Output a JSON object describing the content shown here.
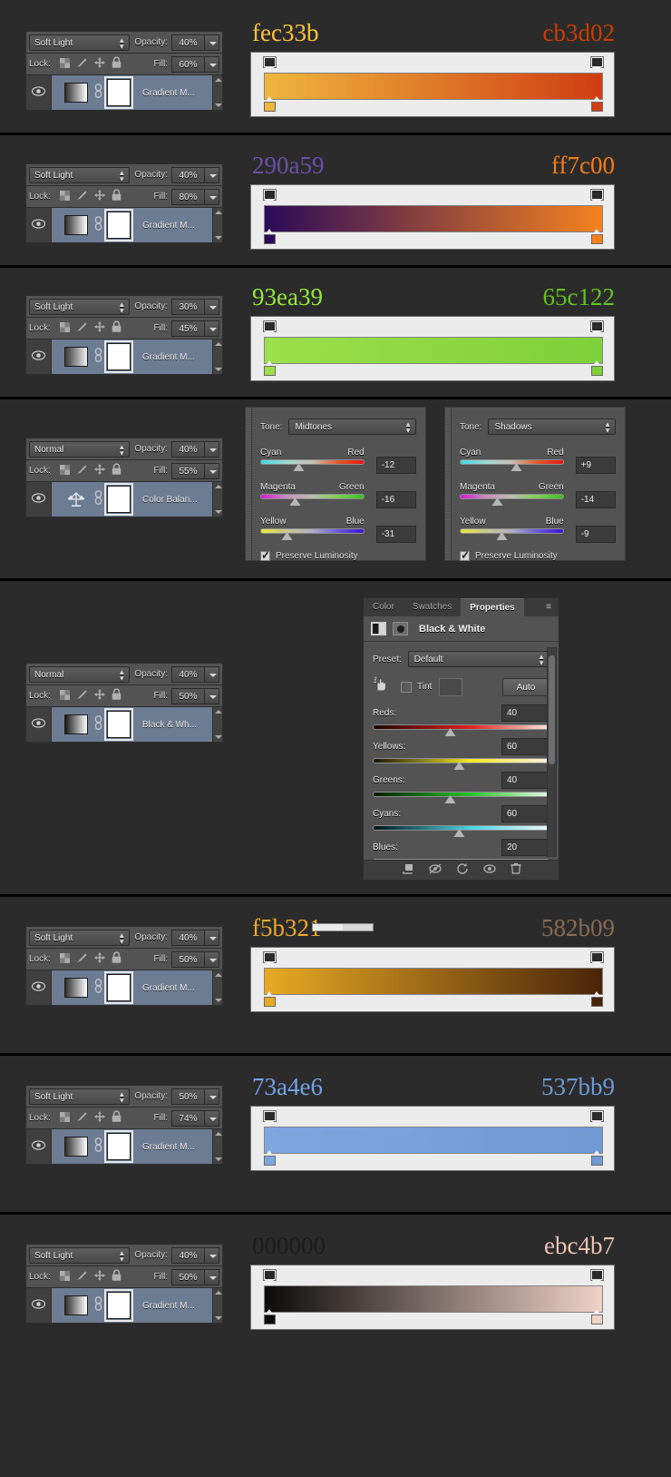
{
  "sections": [
    {
      "id": "s1",
      "type": "gradient",
      "layers": {
        "blend_mode": "Soft Light",
        "opacity_label": "Opacity:",
        "opacity_value": "40%",
        "lock_label": "Lock:",
        "fill_label": "Fill:",
        "fill_value": "60%",
        "layer_name": "Gradient M...",
        "thumb_from": "#2f2f2f",
        "thumb_to": "#ffffff"
      },
      "gradient": {
        "left_hex": "fec33b",
        "right_hex": "cb3d02",
        "left_color": "#fec33b",
        "right_color": "#cb3d02",
        "bar_from": "#f0b63e",
        "bar_to": "#cf3d12"
      }
    },
    {
      "id": "s2",
      "type": "gradient",
      "layers": {
        "blend_mode": "Soft Light",
        "opacity_label": "Opacity:",
        "opacity_value": "40%",
        "lock_label": "Lock:",
        "fill_label": "Fill:",
        "fill_value": "80%",
        "layer_name": "Gradient M...",
        "thumb_from": "#2f2f2f",
        "thumb_to": "#ffffff"
      },
      "gradient": {
        "left_hex": "290a59",
        "right_hex": "ff7c00",
        "left_color": "#6a4fa8",
        "right_color": "#f97c14",
        "bar_from": "#2b0a5a",
        "bar_to": "#f5821f"
      }
    },
    {
      "id": "s3",
      "type": "gradient",
      "layers": {
        "blend_mode": "Soft Light",
        "opacity_label": "Opacity:",
        "opacity_value": "30%",
        "lock_label": "Lock:",
        "fill_label": "Fill:",
        "fill_value": "45%",
        "layer_name": "Gradient M...",
        "thumb_from": "#3a3a3a",
        "thumb_to": "#f0f0f0"
      },
      "gradient": {
        "left_hex": "93ea39",
        "right_hex": "65c122",
        "left_color": "#93ea39",
        "right_color": "#65c122",
        "bar_from": "#9ce04b",
        "bar_to": "#7ed03a"
      }
    },
    {
      "id": "s4",
      "type": "color-balance",
      "layers": {
        "blend_mode": "Normal",
        "opacity_label": "Opacity:",
        "opacity_value": "40%",
        "lock_label": "Lock:",
        "fill_label": "Fill:",
        "fill_value": "55%",
        "layer_name": "Color Balan...",
        "thumb_from": "#6c7c92",
        "thumb_to": "#6c7c92"
      },
      "panels": [
        {
          "tone_label": "Tone:",
          "tone_value": "Midtones",
          "sliders": [
            {
              "left": "Cyan",
              "right": "Red",
              "value": "-12",
              "pos": 37
            },
            {
              "left": "Magenta",
              "right": "Green",
              "value": "-16",
              "pos": 34
            },
            {
              "left": "Yellow",
              "right": "Blue",
              "value": "-31",
              "pos": 26
            }
          ],
          "preserve_label": "Preserve Luminosity",
          "preserve_checked": true
        },
        {
          "tone_label": "Tone:",
          "tone_value": "Shadows",
          "sliders": [
            {
              "left": "Cyan",
              "right": "Red",
              "value": "+9",
              "pos": 55
            },
            {
              "left": "Magenta",
              "right": "Green",
              "value": "-14",
              "pos": 36
            },
            {
              "left": "Yellow",
              "right": "Blue",
              "value": "-9",
              "pos": 41
            }
          ],
          "preserve_label": "Preserve Luminosity",
          "preserve_checked": true
        }
      ]
    },
    {
      "id": "s5",
      "type": "black-white",
      "layers": {
        "blend_mode": "Normal",
        "opacity_label": "Opacity:",
        "opacity_value": "40%",
        "lock_label": "Lock:",
        "fill_label": "Fill:",
        "fill_value": "50%",
        "layer_name": "Black & Wh...",
        "thumb_from": "#1a1a1a",
        "thumb_to": "#ffffff"
      },
      "properties": {
        "tabs": [
          {
            "label": "Color",
            "active": false
          },
          {
            "label": "Swatches",
            "active": false
          },
          {
            "label": "Properties",
            "active": true
          }
        ],
        "menu_icon": "panel-menu-icon",
        "title": "Black & White",
        "preset_label": "Preset:",
        "preset_value": "Default",
        "tint_label": "Tint",
        "tint_checked": false,
        "auto_label": "Auto",
        "channels": [
          {
            "name": "Reds:",
            "value": "40",
            "pos": 44,
            "from": "#1a0505",
            "mid": "#e01f1f",
            "to": "#f6e6dd"
          },
          {
            "name": "Yellows:",
            "value": "60",
            "pos": 49,
            "from": "#1a1505",
            "mid": "#f2ea22",
            "to": "#f8f0e2"
          },
          {
            "name": "Greens:",
            "value": "40",
            "pos": 44,
            "from": "#071a07",
            "mid": "#24c224",
            "to": "#e8f6e8"
          },
          {
            "name": "Cyans:",
            "value": "60",
            "pos": 49,
            "from": "#05141a",
            "mid": "#4ad2e0",
            "to": "#e8f7fa"
          },
          {
            "name": "Blues:",
            "value": "20",
            "pos": 41,
            "from": "#05051a",
            "mid": "#3b3bd2",
            "to": "#e6e6f8"
          }
        ],
        "footer_icons": [
          "clip-to-layer-icon",
          "view-previous-state-icon",
          "reset-icon",
          "toggle-visibility-icon",
          "delete-icon"
        ]
      }
    },
    {
      "id": "s6",
      "type": "gradient",
      "layers": {
        "blend_mode": "Soft Light",
        "opacity_label": "Opacity:",
        "opacity_value": "40%",
        "lock_label": "Lock:",
        "fill_label": "Fill:",
        "fill_value": "50%",
        "layer_name": "Gradient M...",
        "thumb_from": "#2f2f2f",
        "thumb_to": "#ffffff"
      },
      "gradient": {
        "left_hex": "f5b321",
        "right_hex": "582b09",
        "left_color": "#f0a828",
        "right_color": "#8a6a52",
        "bar_from": "#e8aa22",
        "bar_to": "#4a2408"
      }
    },
    {
      "id": "s7",
      "type": "gradient",
      "layers": {
        "blend_mode": "Soft Light",
        "opacity_label": "Opacity:",
        "opacity_value": "50%",
        "lock_label": "Lock:",
        "fill_label": "Fill:",
        "fill_value": "74%",
        "layer_name": "Gradient M...",
        "thumb_from": "#2f2f2f",
        "thumb_to": "#ffffff"
      },
      "gradient": {
        "left_hex": "73a4e6",
        "right_hex": "537bb9",
        "left_color": "#73a4e6",
        "right_color": "#6e9ad6",
        "bar_from": "#7ea7e0",
        "bar_to": "#6f9ad4"
      }
    },
    {
      "id": "s8",
      "type": "gradient",
      "layers": {
        "blend_mode": "Soft Light",
        "opacity_label": "Opacity:",
        "opacity_value": "40%",
        "lock_label": "Lock:",
        "fill_label": "Fill:",
        "fill_value": "50%",
        "layer_name": "Gradient M...",
        "thumb_from": "#2f2f2f",
        "thumb_to": "#ffffff"
      },
      "gradient": {
        "left_hex": "000000",
        "right_hex": "ebc4b7",
        "left_color": "#1c1c1c",
        "right_color": "#eac3b6",
        "bar_from": "#0b0b0b",
        "bar_to": "#f0d2c6"
      }
    }
  ],
  "icons": {
    "eye": "eye-icon",
    "lock_transparent": "lock-transparent-pixels-icon",
    "lock_image": "lock-image-pixels-icon",
    "lock_position": "lock-position-icon",
    "lock_all": "lock-all-icon",
    "link": "link-mask-icon",
    "gradient_thumb": "gradient-thumbnail-icon",
    "balance_thumb": "color-balance-thumbnail-icon",
    "bw_thumb": "black-white-thumbnail-icon"
  }
}
